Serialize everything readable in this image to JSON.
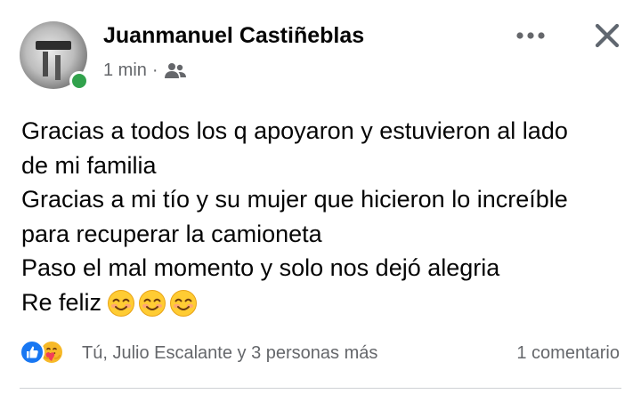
{
  "post": {
    "author": {
      "name": "Juanmanuel Castiñeblas",
      "online": true
    },
    "timestamp": "1 min",
    "separator": "·",
    "audience_icon": "friends-icon",
    "header_actions": {
      "more_icon": "more-horizontal-icon",
      "close_icon": "close-icon"
    },
    "body_lines": [
      "Gracias a todos los q apoyaron y estuvieron al lado",
      "de mi familia",
      "Gracias a mi tío y su mujer que hicieron lo increíble",
      "para recuperar la camioneta",
      "Paso el mal momento y solo nos dejó alegria",
      "Re feliz"
    ],
    "emojis": [
      "smiling-face-icon",
      "smiling-face-icon",
      "smiling-face-icon"
    ],
    "reactions": {
      "icons": [
        "like-reaction-icon",
        "care-reaction-icon"
      ],
      "summary": "Tú, Julio Escalante y 3 personas más"
    },
    "comments_count": "1 comentario"
  },
  "colors": {
    "online": "#31a24c",
    "like_blue": "#1877f2",
    "care_yellow": "#f7b928",
    "secondary_text": "#65676b",
    "primary_text": "#050505"
  }
}
